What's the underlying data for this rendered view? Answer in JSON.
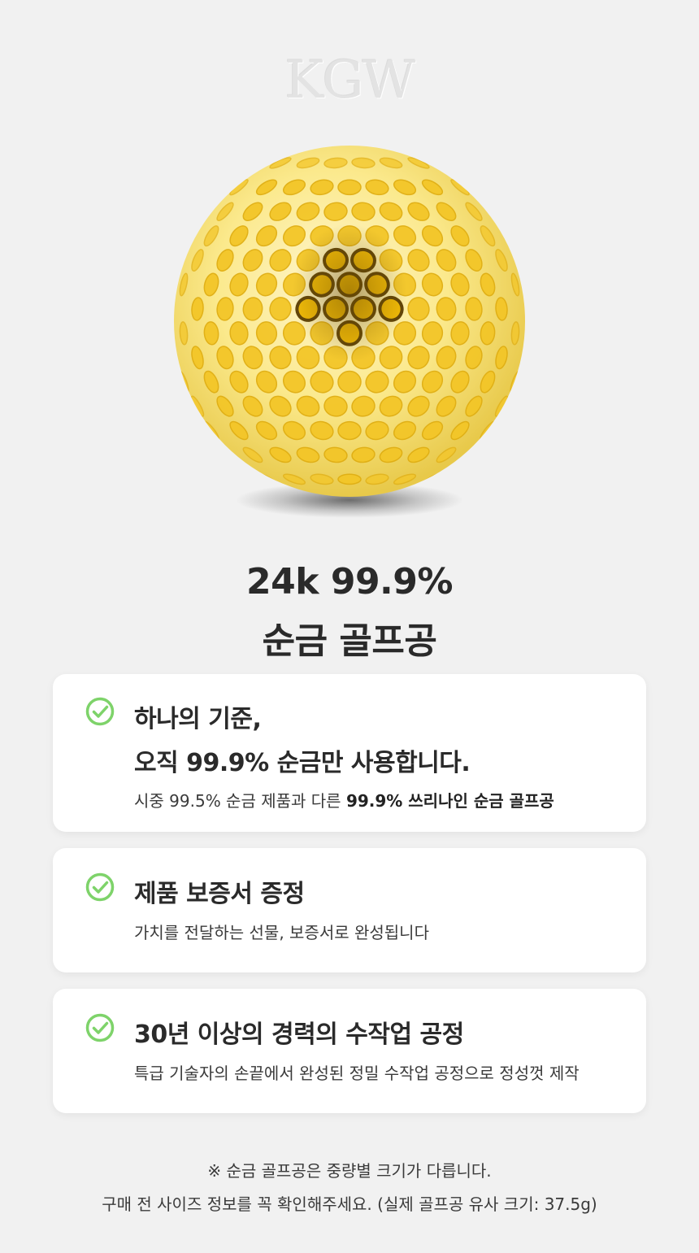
{
  "brand": {
    "logo_text": "KGW"
  },
  "product": {
    "image_icon": "gold-golf-ball-icon"
  },
  "headline": {
    "line1": "24k 99.9%",
    "line2": "순금 골프공"
  },
  "features": [
    {
      "icon": "check-circle-icon",
      "title_line1": "하나의 기준,",
      "title_line2": "오직 99.9% 순금만 사용합니다.",
      "desc_plain": "시중 99.5% 순금 제품과 다른 ",
      "desc_bold": "99.9% 쓰리나인 순금 골프공"
    },
    {
      "icon": "check-circle-icon",
      "title": "제품 보증서 증정",
      "desc": "가치를 전달하는 선물, 보증서로 완성됩니다"
    },
    {
      "icon": "check-circle-icon",
      "title": "30년 이상의 경력의 수작업 공정",
      "desc": "특급 기술자의 손끝에서 완성된 정밀 수작업 공정으로 정성껏 제작"
    }
  ],
  "notes": {
    "line1": "※ 순금 골프공은 중량별 크기가 다릅니다.",
    "line2": "구매 전 사이즈 정보를 꼭 확인해주세요. (실제 골프공 유사 크기: 37.5g)"
  },
  "colors": {
    "check": "#7ed36a",
    "gold_light": "#fbe77a",
    "gold_dimple": "#f2c21a",
    "background": "#f1f1f1"
  }
}
